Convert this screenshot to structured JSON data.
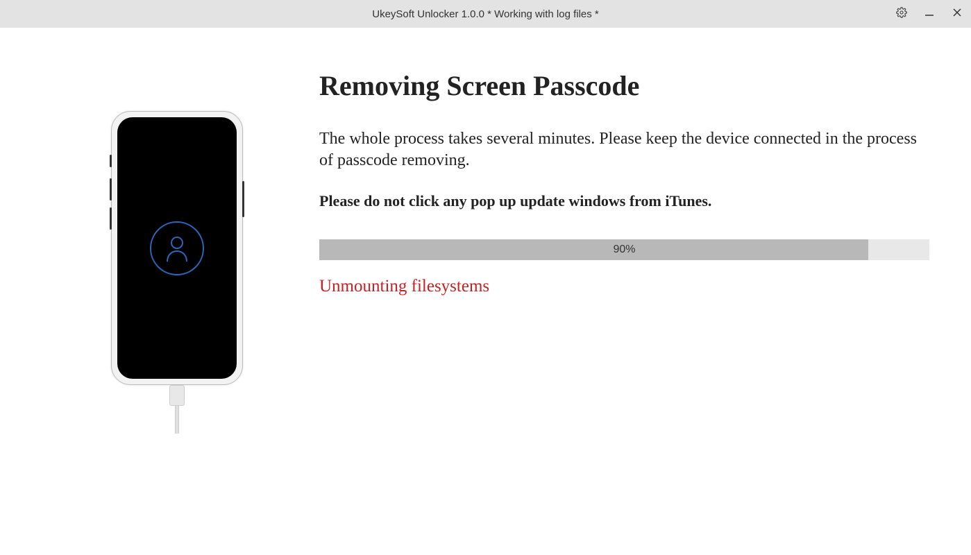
{
  "titlebar": {
    "title": "UkeySoft Unlocker 1.0.0 * Working with log files *"
  },
  "main": {
    "heading": "Removing Screen Passcode",
    "description": "The whole process takes several minutes. Please keep the device connected in the process of passcode removing.",
    "warning": "Please do not click any pop up update windows from iTunes.",
    "progress_percent": 90,
    "progress_label": "90%",
    "status_text": "Unmounting filesystems"
  },
  "icons": {
    "settings": "gear-icon",
    "minimize": "minimize-icon",
    "close": "close-icon",
    "user": "user-icon"
  },
  "colors": {
    "status_red": "#cc2020",
    "progress_fill": "#b8b8b8",
    "progress_bg": "#e8e8e8",
    "accent_blue": "#2868b8"
  }
}
